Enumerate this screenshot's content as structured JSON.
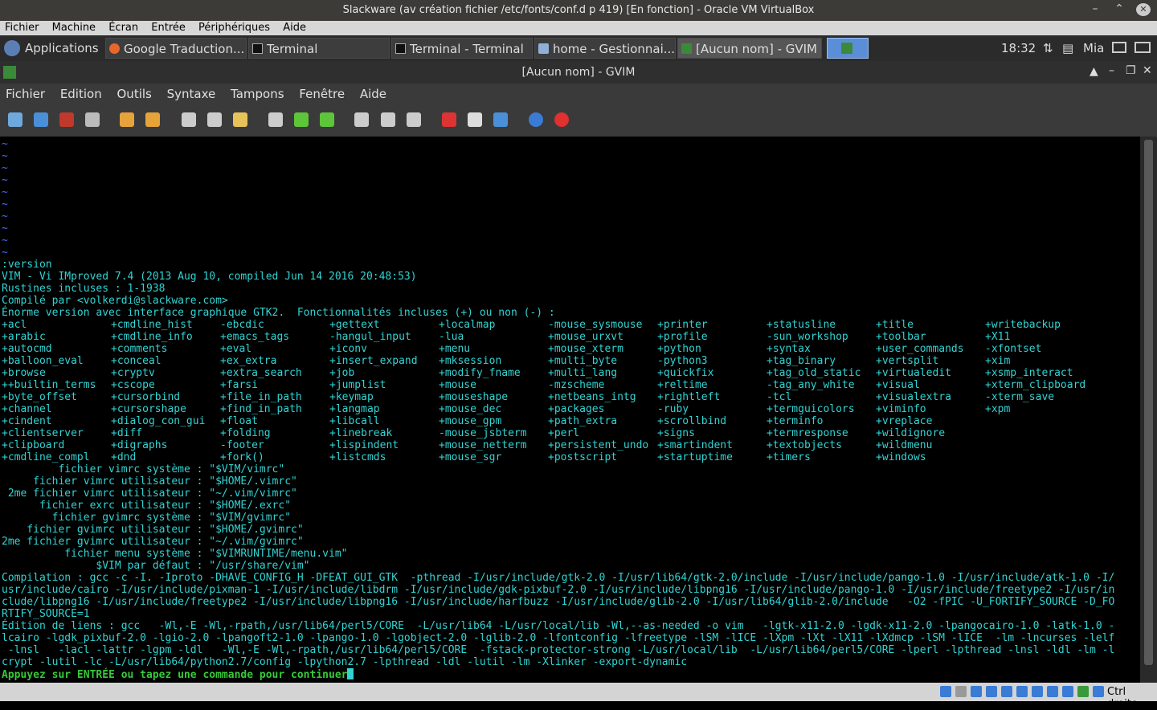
{
  "vbox": {
    "title": "Slackware (av création fichier /etc/fonts/conf.d p 419) [En fonction] - Oracle VM VirtualBox",
    "menu": [
      "Fichier",
      "Machine",
      "Écran",
      "Entrée",
      "Périphériques",
      "Aide"
    ],
    "status_host_key": "Ctrl droite"
  },
  "panel": {
    "apps_label": "Applications",
    "tasks": [
      {
        "label": "Google Traduction...",
        "icon": "firefox-icon"
      },
      {
        "label": "Terminal",
        "icon": "terminal-icon"
      },
      {
        "label": "Terminal - Terminal",
        "icon": "terminal-icon"
      },
      {
        "label": "home - Gestionnai...",
        "icon": "folder-icon"
      },
      {
        "label": "[Aucun nom] - GVIM",
        "icon": "gvim-icon"
      }
    ],
    "clock": "18:32",
    "user": "Mia"
  },
  "gvim": {
    "title": "[Aucun nom] - GVIM",
    "menu": [
      "Fichier",
      "Edition",
      "Outils",
      "Syntaxe",
      "Tampons",
      "Fenêtre",
      "Aide"
    ],
    "toolbar": [
      "open-icon",
      "save-icon",
      "save-all-icon",
      "print-icon",
      "undo-icon",
      "redo-icon",
      "cut-icon",
      "copy-icon",
      "paste-icon",
      "replace-icon",
      "find-next-icon",
      "find-prev-icon",
      "load-session-icon",
      "save-session-icon",
      "run-script-icon",
      "make-icon",
      "run-ctags-icon",
      "jump-tag-icon",
      "help-icon",
      "find-help-icon"
    ]
  },
  "editor": {
    "tildes": 10,
    "header": [
      ":version",
      "VIM - Vi IMproved 7.4 (2013 Aug 10, compiled Jun 14 2016 20:48:53)",
      "Rustines incluses : 1-1938",
      "Compilé par <volkerdi@slackware.com>",
      "Énorme version avec interface graphique GTK2.  Fonctionnalités incluses (+) ou non (-) :"
    ],
    "features": [
      [
        "+acl",
        "+arabic",
        "+autocmd",
        "+balloon_eval",
        "+browse",
        "++builtin_terms",
        "+byte_offset",
        "+channel",
        "+cindent",
        "+clientserver",
        "+clipboard",
        "+cmdline_compl"
      ],
      [
        "+cmdline_hist",
        "+cmdline_info",
        "+comments",
        "+conceal",
        "+cryptv",
        "+cscope",
        "+cursorbind",
        "+cursorshape",
        "+dialog_con_gui",
        "+diff",
        "+digraphs",
        "+dnd"
      ],
      [
        "-ebcdic",
        "+emacs_tags",
        "+eval",
        "+ex_extra",
        "+extra_search",
        "+farsi",
        "+file_in_path",
        "+find_in_path",
        "+float",
        "+folding",
        "-footer",
        "+fork()"
      ],
      [
        "+gettext",
        "-hangul_input",
        "+iconv",
        "+insert_expand",
        "+job",
        "+jumplist",
        "+keymap",
        "+langmap",
        "+libcall",
        "+linebreak",
        "+lispindent",
        "+listcmds"
      ],
      [
        "+localmap",
        "-lua",
        "+menu",
        "+mksession",
        "+modify_fname",
        "+mouse",
        "+mouseshape",
        "+mouse_dec",
        "+mouse_gpm",
        "-mouse_jsbterm",
        "+mouse_netterm",
        "+mouse_sgr"
      ],
      [
        "-mouse_sysmouse",
        "+mouse_urxvt",
        "+mouse_xterm",
        "+multi_byte",
        "+multi_lang",
        "-mzscheme",
        "+netbeans_intg",
        "+packages",
        "+path_extra",
        "+perl",
        "+persistent_undo",
        "+postscript"
      ],
      [
        "+printer",
        "+profile",
        "+python",
        "-python3",
        "+quickfix",
        "+reltime",
        "+rightleft",
        "-ruby",
        "+scrollbind",
        "+signs",
        "+smartindent",
        "+startuptime"
      ],
      [
        "+statusline",
        "-sun_workshop",
        "+syntax",
        "+tag_binary",
        "+tag_old_static",
        "-tag_any_white",
        "-tcl",
        "+termguicolors",
        "+terminfo",
        "+termresponse",
        "+textobjects",
        "+timers"
      ],
      [
        "+title",
        "+toolbar",
        "+user_commands",
        "+vertsplit",
        "+virtualedit",
        "+visual",
        "+visualextra",
        "+viminfo",
        "+vreplace",
        "+wildignore",
        "+wildmenu",
        "+windows"
      ],
      [
        "+writebackup",
        "+X11",
        "-xfontset",
        "+xim",
        "+xsmp_interact",
        "+xterm_clipboard",
        "-xterm_save",
        "+xpm"
      ]
    ],
    "files": [
      "         fichier vimrc système : \"$VIM/vimrc\"",
      "     fichier vimrc utilisateur : \"$HOME/.vimrc\"",
      " 2me fichier vimrc utilisateur : \"~/.vim/vimrc\"",
      "      fichier exrc utilisateur : \"$HOME/.exrc\"",
      "        fichier gvimrc système : \"$VIM/gvimrc\"",
      "    fichier gvimrc utilisateur : \"$HOME/.gvimrc\"",
      "2me fichier gvimrc utilisateur : \"~/.vim/gvimrc\"",
      "          fichier menu système : \"$VIMRUNTIME/menu.vim\"",
      "               $VIM par défaut : \"/usr/share/vim\""
    ],
    "compile": [
      "Compilation : gcc -c -I. -Iproto -DHAVE_CONFIG_H -DFEAT_GUI_GTK  -pthread -I/usr/include/gtk-2.0 -I/usr/lib64/gtk-2.0/include -I/usr/include/pango-1.0 -I/usr/include/atk-1.0 -I/",
      "usr/include/cairo -I/usr/include/pixman-1 -I/usr/include/libdrm -I/usr/include/gdk-pixbuf-2.0 -I/usr/include/libpng16 -I/usr/include/pango-1.0 -I/usr/include/freetype2 -I/usr/in",
      "clude/libpng16 -I/usr/include/freetype2 -I/usr/include/libpng16 -I/usr/include/harfbuzz -I/usr/include/glib-2.0 -I/usr/lib64/glib-2.0/include   -O2 -fPIC -U_FORTIFY_SOURCE -D_FO",
      "RTIFY_SOURCE=1",
      "Édition de liens : gcc   -Wl,-E -Wl,-rpath,/usr/lib64/perl5/CORE  -L/usr/lib64 -L/usr/local/lib -Wl,--as-needed -o vim   -lgtk-x11-2.0 -lgdk-x11-2.0 -lpangocairo-1.0 -latk-1.0 -",
      "lcairo -lgdk_pixbuf-2.0 -lgio-2.0 -lpangoft2-1.0 -lpango-1.0 -lgobject-2.0 -lglib-2.0 -lfontconfig -lfreetype -lSM -lICE -lXpm -lXt -lX11 -lXdmcp -lSM -lICE  -lm -lncurses -lelf",
      " -lnsl   -lacl -lattr -lgpm -ldl   -Wl,-E -Wl,-rpath,/usr/lib64/perl5/CORE  -fstack-protector-strong -L/usr/local/lib  -L/usr/lib64/perl5/CORE -lperl -lpthread -lnsl -ldl -lm -l",
      "crypt -lutil -lc -L/usr/lib64/python2.7/config -lpython2.7 -lpthread -ldl -lutil -lm -Xlinker -export-dynamic"
    ],
    "prompt": "Appuyez sur ENTRÉE ou tapez une commande pour continuer"
  }
}
